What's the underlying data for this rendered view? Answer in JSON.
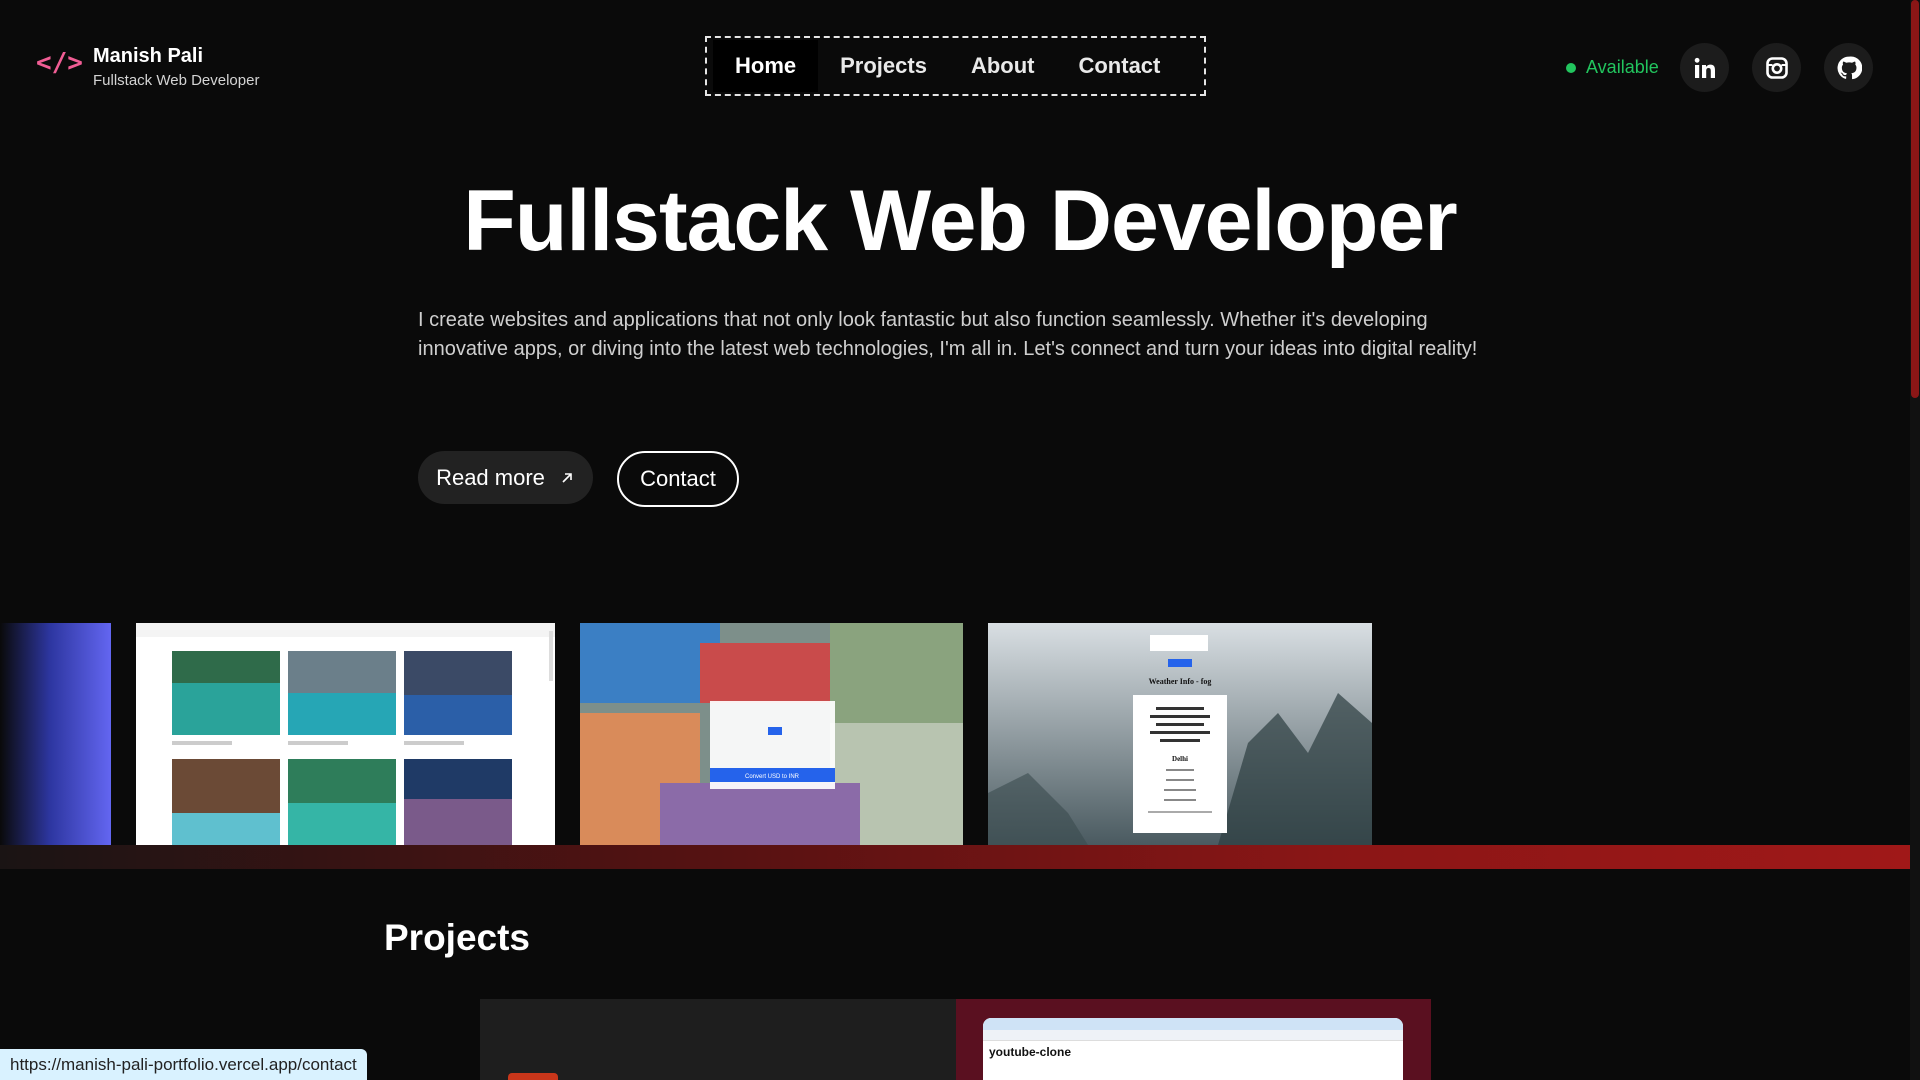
{
  "header": {
    "brand_name": "Manish Pali",
    "brand_role": "Fullstack Web Developer",
    "logo_glyph": "</>",
    "nav": [
      {
        "label": "Home",
        "active": true
      },
      {
        "label": "Projects",
        "active": false
      },
      {
        "label": "About",
        "active": false
      },
      {
        "label": "Contact",
        "active": false
      }
    ],
    "status": "Available",
    "socials": [
      "linkedin-icon",
      "instagram-icon",
      "github-icon"
    ]
  },
  "hero": {
    "title": "Fullstack Web Developer",
    "description": "I create websites and applications that not only look fantastic but also function seamlessly. Whether it's developing innovative apps, or diving into the latest web technologies, I'm all in. Let's connect and turn your ideas into digital reality!",
    "read_more": "Read more",
    "contact": "Contact"
  },
  "carousel": {
    "weather_label": "Weather Info - fog",
    "weather_city": "Delhi",
    "currency_button": "Convert USD to INR"
  },
  "projects": {
    "heading": "Projects",
    "card_title": "youtube-clone"
  },
  "status_bar_url": "https://manish-pali-portfolio.vercel.app/contact",
  "colors": {
    "accent_pink": "#f05d94",
    "available_green": "#22c55e",
    "accent_red": "#8b1616"
  }
}
